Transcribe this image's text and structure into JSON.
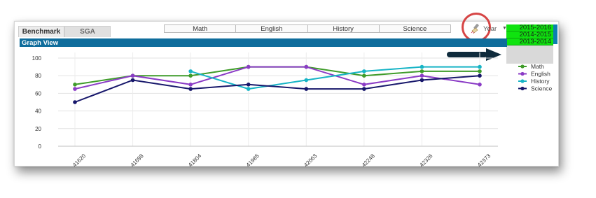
{
  "tabs": [
    {
      "label": "Benchmark",
      "active": true
    },
    {
      "label": "SGA",
      "active": false
    }
  ],
  "subjects_filter": [
    "Math",
    "English",
    "History",
    "Science"
  ],
  "year_filter": {
    "label": "Year",
    "options": [
      "2015-2016",
      "2014-2015",
      "2013-2014"
    ]
  },
  "graph_title": "Graph View",
  "icons": {
    "clear_selection": "eraser-brush-icon",
    "dropdown": "caret-down-icon",
    "pointer": "right-arrow-icon"
  },
  "colors": {
    "header": "#0f6d9c",
    "selected": "#0fe30f",
    "highlight": "#d64545",
    "Math": "#3f9c2a",
    "English": "#8b3cc6",
    "History": "#17b4c6",
    "Science": "#17176b"
  },
  "chart_data": {
    "type": "line",
    "x": [
      "41620",
      "41698",
      "41804",
      "41985",
      "42063",
      "42248",
      "42326",
      "42373"
    ],
    "ylim": [
      0,
      100
    ],
    "yticks": [
      0,
      20,
      40,
      60,
      80,
      100
    ],
    "grid": true,
    "legend_position": "right",
    "series": [
      {
        "name": "Math",
        "values": [
          70,
          80,
          80,
          90,
          90,
          80,
          85,
          85
        ]
      },
      {
        "name": "English",
        "values": [
          65,
          80,
          70,
          90,
          90,
          70,
          80,
          70
        ]
      },
      {
        "name": "History",
        "values": [
          null,
          null,
          85,
          65,
          75,
          85,
          90,
          90
        ]
      },
      {
        "name": "Science",
        "values": [
          50,
          75,
          65,
          70,
          65,
          65,
          75,
          80
        ]
      }
    ]
  }
}
